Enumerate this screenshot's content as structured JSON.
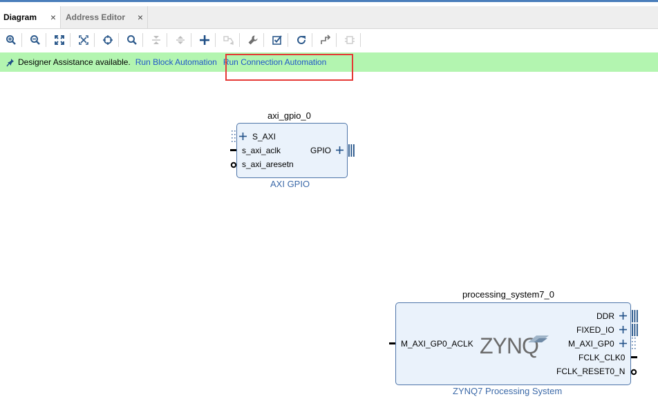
{
  "tabs": [
    {
      "label": "Diagram",
      "active": true
    },
    {
      "label": "Address Editor",
      "active": false
    }
  ],
  "toolbar": {
    "icons": [
      "zoom-in-icon",
      "zoom-out-icon",
      "zoom-fit-icon",
      "fit-selection-icon",
      "auto-connect-icon",
      "search-icon",
      "collapse-all-icon",
      "expand-all-icon",
      "add-ip-icon",
      "make-connection-icon",
      "customize-block-icon",
      "validate-design-icon",
      "regenerate-layout-icon",
      "optimize-routing-icon",
      "create-hierarchy-icon"
    ]
  },
  "assistance": {
    "message": "Designer Assistance available.",
    "run_block_automation": "Run Block Automation",
    "run_connection_automation": "Run Connection Automation"
  },
  "colors": {
    "tab_bar": "#eeeeee",
    "assistance_bg": "#b3f5b0",
    "link": "#1f55c9",
    "highlight_box": "#e53935",
    "block_fill": "#eaf2fb",
    "block_border": "#4d74a8",
    "block_type_label": "#3b69a8"
  },
  "blocks": {
    "gpio": {
      "instance": "axi_gpio_0",
      "type": "AXI GPIO",
      "ports_left": [
        "S_AXI",
        "s_axi_aclk",
        "s_axi_aresetn"
      ],
      "ports_right": [
        "GPIO"
      ]
    },
    "ps7": {
      "instance": "processing_system7_0",
      "type": "ZYNQ7 Processing System",
      "logo": "ZYNQ",
      "ports_left": [
        "M_AXI_GP0_ACLK"
      ],
      "ports_right": [
        "DDR",
        "FIXED_IO",
        "M_AXI_GP0",
        "FCLK_CLK0",
        "FCLK_RESET0_N"
      ]
    }
  }
}
